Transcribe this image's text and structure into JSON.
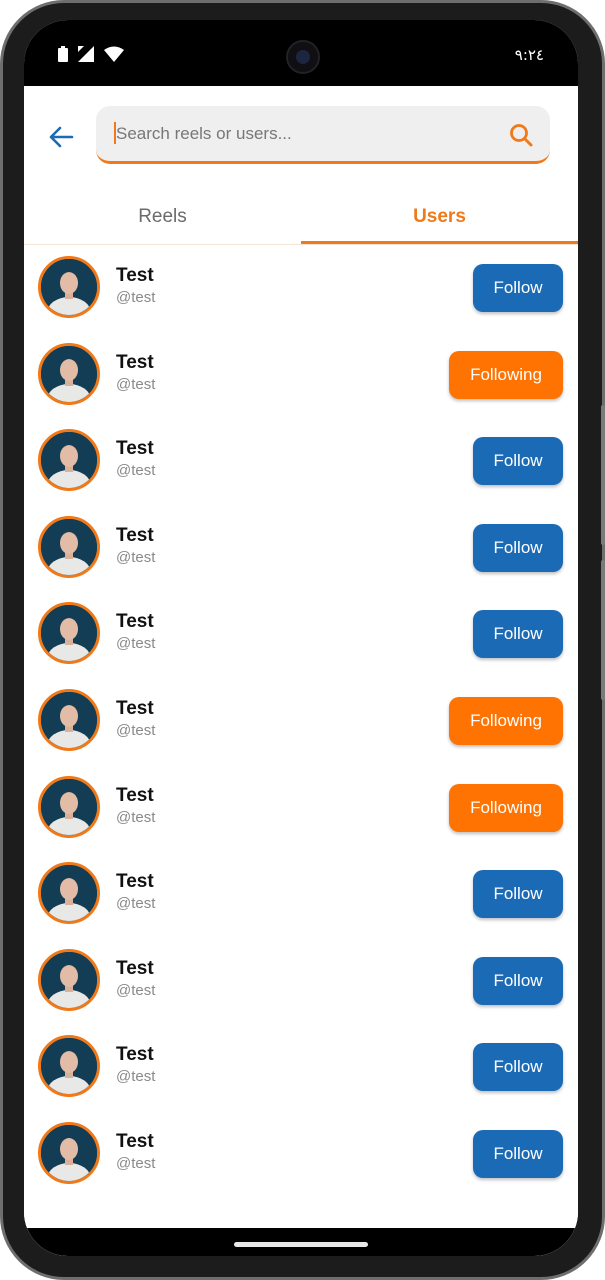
{
  "status_bar": {
    "time": "٩:٢٤"
  },
  "search": {
    "placeholder": "Search reels or users..."
  },
  "tabs": [
    {
      "label": "Reels",
      "active": false
    },
    {
      "label": "Users",
      "active": true
    }
  ],
  "colors": {
    "accent": "#f07a1a",
    "follow": "#1b6ab5",
    "following": "#fe7301"
  },
  "users": [
    {
      "name": "Test",
      "handle": "@test",
      "button": "Follow"
    },
    {
      "name": "Test",
      "handle": "@test",
      "button": "Following"
    },
    {
      "name": "Test",
      "handle": "@test",
      "button": "Follow"
    },
    {
      "name": "Test",
      "handle": "@test",
      "button": "Follow"
    },
    {
      "name": "Test",
      "handle": "@test",
      "button": "Follow"
    },
    {
      "name": "Test",
      "handle": "@test",
      "button": "Following"
    },
    {
      "name": "Test",
      "handle": "@test",
      "button": "Following"
    },
    {
      "name": "Test",
      "handle": "@test",
      "button": "Follow"
    },
    {
      "name": "Test",
      "handle": "@test",
      "button": "Follow"
    },
    {
      "name": "Test",
      "handle": "@test",
      "button": "Follow"
    },
    {
      "name": "Test",
      "handle": "@test",
      "button": "Follow"
    }
  ]
}
